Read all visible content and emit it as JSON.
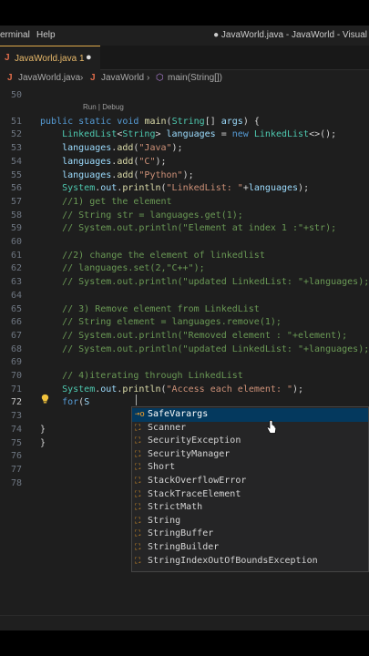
{
  "titlebar": {
    "menu_terminal": "erminal",
    "menu_help": "Help",
    "window_title": "● JavaWorld.java - JavaWorld - Visual"
  },
  "tab": {
    "name": "JavaWorld.java 1",
    "modified": "●"
  },
  "breadcrumb": {
    "file": "JavaWorld.java",
    "cls": "JavaWorld",
    "method": "main(String[])"
  },
  "editor": {
    "codelens": "Run | Debug",
    "lines": [
      {
        "n": "50",
        "t": ""
      },
      {
        "n": "51",
        "t": "public static void main(String[] args) {"
      },
      {
        "n": "52",
        "t": "    LinkedList<String> languages = new LinkedList<>();"
      },
      {
        "n": "53",
        "t": "    languages.add(\"Java\");"
      },
      {
        "n": "54",
        "t": "    languages.add(\"C\");"
      },
      {
        "n": "55",
        "t": "    languages.add(\"Python\");"
      },
      {
        "n": "56",
        "t": "    System.out.println(\"LinkedList: \"+languages);"
      },
      {
        "n": "57",
        "t": "    //1) get the element"
      },
      {
        "n": "58",
        "t": "    // String str = languages.get(1);"
      },
      {
        "n": "59",
        "t": "    // System.out.println(\"Element at index 1 :\"+str);"
      },
      {
        "n": "60",
        "t": ""
      },
      {
        "n": "61",
        "t": "    //2) change the element of linkedlist"
      },
      {
        "n": "62",
        "t": "    // languages.set(2,\"C++\");"
      },
      {
        "n": "63",
        "t": "    // System.out.println(\"updated LinkedList: \"+languages);"
      },
      {
        "n": "64",
        "t": ""
      },
      {
        "n": "65",
        "t": "    // 3) Remove element from LinkedList"
      },
      {
        "n": "66",
        "t": "    // String element = languages.remove(1);"
      },
      {
        "n": "67",
        "t": "    // System.out.println(\"Removed element : \"+element);"
      },
      {
        "n": "68",
        "t": "    // System.out.println(\"updated LinkedList: \"+languages);"
      },
      {
        "n": "69",
        "t": ""
      },
      {
        "n": "70",
        "t": "    // 4)iterating through LinkedList"
      },
      {
        "n": "71",
        "t": "    System.out.println(\"Access each element: \");"
      },
      {
        "n": "72",
        "t": "    for(S"
      },
      {
        "n": "73",
        "t": ""
      },
      {
        "n": "74",
        "t": "}"
      },
      {
        "n": "75",
        "t": "}"
      },
      {
        "n": "76",
        "t": ""
      },
      {
        "n": "77",
        "t": ""
      },
      {
        "n": "78",
        "t": ""
      }
    ]
  },
  "suggestions": {
    "selected_index": 0,
    "items": [
      {
        "icon": "⊸o",
        "label": "SafeVarargs"
      },
      {
        "icon": "⛶",
        "label": "Scanner"
      },
      {
        "icon": "⛶",
        "label": "SecurityException"
      },
      {
        "icon": "⛶",
        "label": "SecurityManager"
      },
      {
        "icon": "⛶",
        "label": "Short"
      },
      {
        "icon": "⛶",
        "label": "StackOverflowError"
      },
      {
        "icon": "⛶",
        "label": "StackTraceElement"
      },
      {
        "icon": "⛶",
        "label": "StrictMath"
      },
      {
        "icon": "⛶",
        "label": "String"
      },
      {
        "icon": "⛶",
        "label": "StringBuffer"
      },
      {
        "icon": "⛶",
        "label": "StringBuilder"
      },
      {
        "icon": "⛶",
        "label": "StringIndexOutOfBoundsException"
      }
    ]
  },
  "colors": {
    "keyword": "#569cd6",
    "type": "#4ec9b0",
    "string": "#ce9178",
    "comment": "#6a9955",
    "selection": "#04395e"
  }
}
